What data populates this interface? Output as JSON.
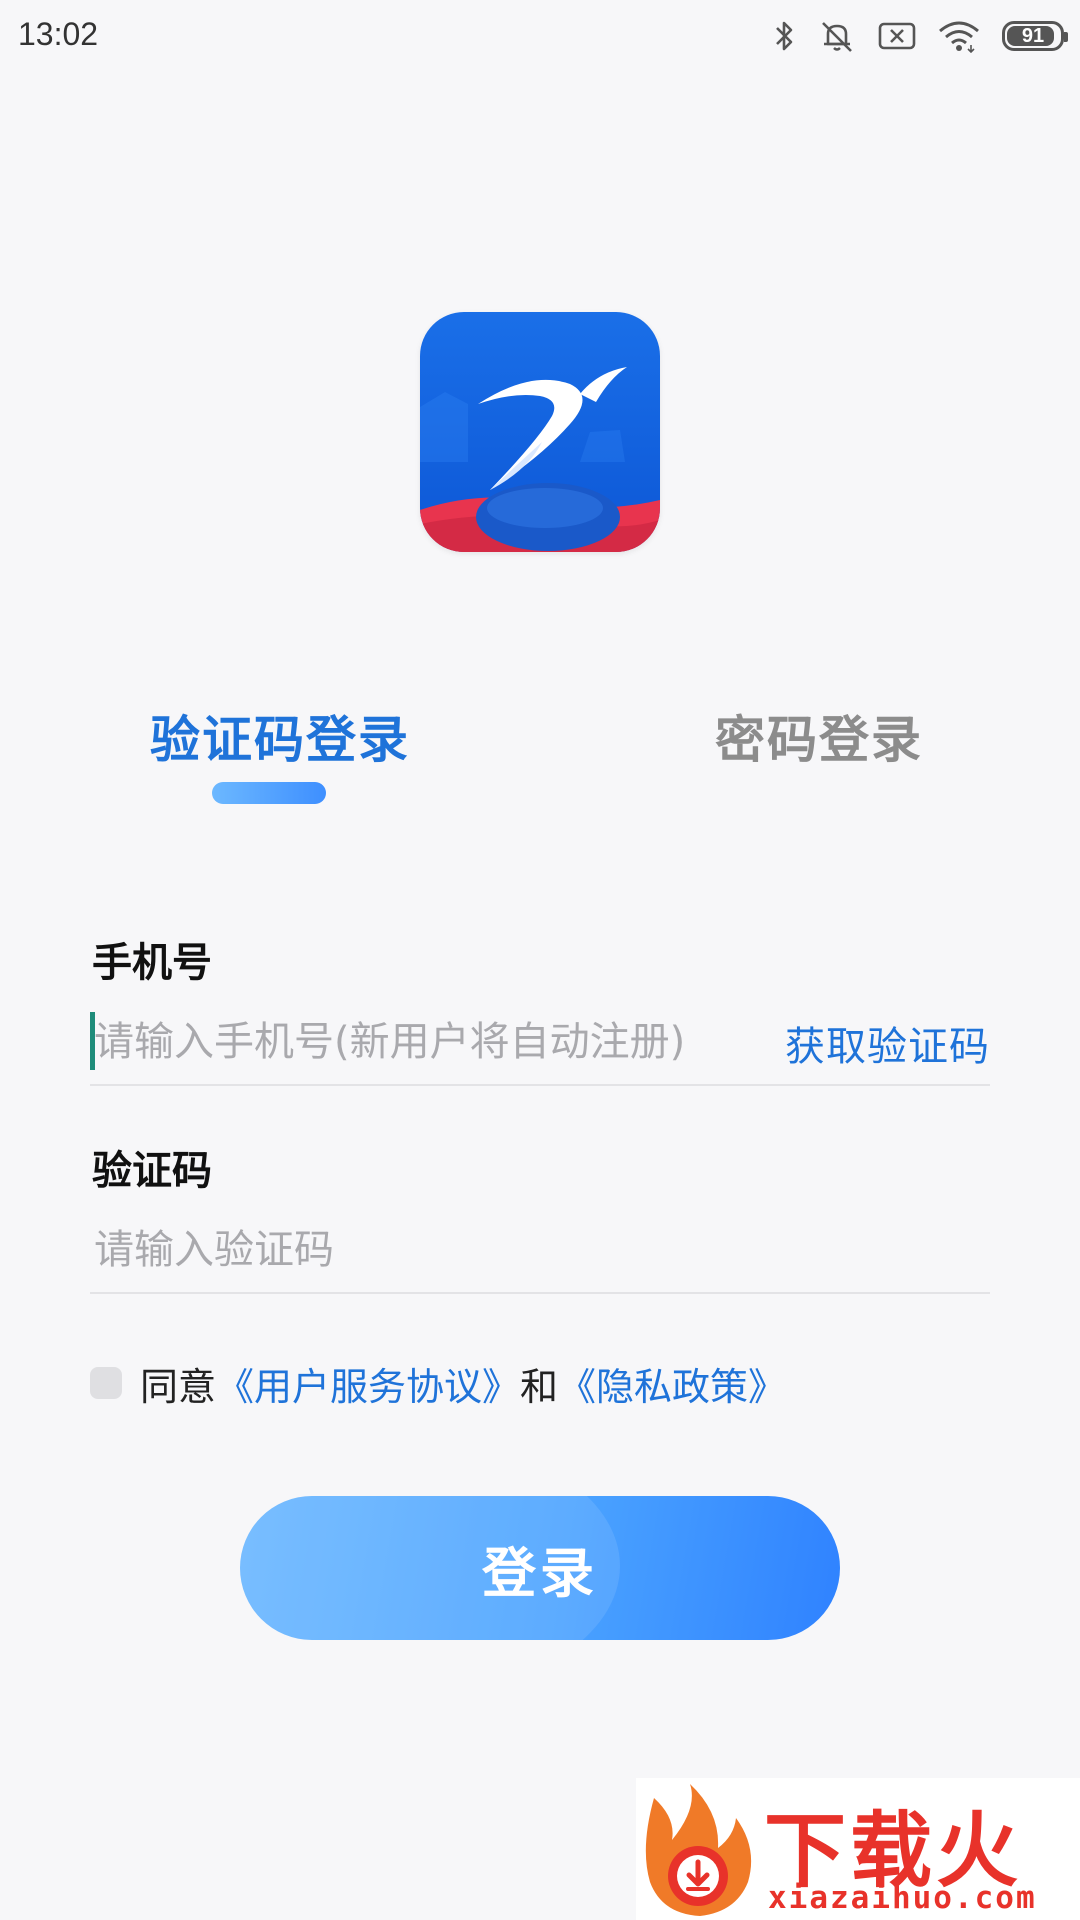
{
  "status_bar": {
    "time": "13:02",
    "battery_level": "91",
    "icons": [
      "bluetooth-icon",
      "mute-icon",
      "no-sim-icon",
      "wifi-icon",
      "battery-icon"
    ]
  },
  "tabs": [
    {
      "label": "验证码登录",
      "active": true
    },
    {
      "label": "密码登录",
      "active": false
    }
  ],
  "form": {
    "phone_label": "手机号",
    "phone_placeholder": "请输入手机号(新用户将自动注册)",
    "get_code_label": "获取验证码",
    "code_label": "验证码",
    "code_placeholder": "请输入验证码"
  },
  "agreement": {
    "prefix": "同意",
    "terms_link": "《用户服务协议》",
    "conjunction": "和",
    "privacy_link": "《隐私政策》",
    "checked": false
  },
  "login_button": {
    "label": "登录"
  },
  "watermark": {
    "brand": "下载火",
    "url": "xiazaihuo.com"
  },
  "colors": {
    "accent": "#1f73d9",
    "inactive_tab": "#8c8c8c",
    "button_start": "#6ab7ff",
    "button_end": "#2f82ff",
    "watermark_red": "#e8322a"
  }
}
